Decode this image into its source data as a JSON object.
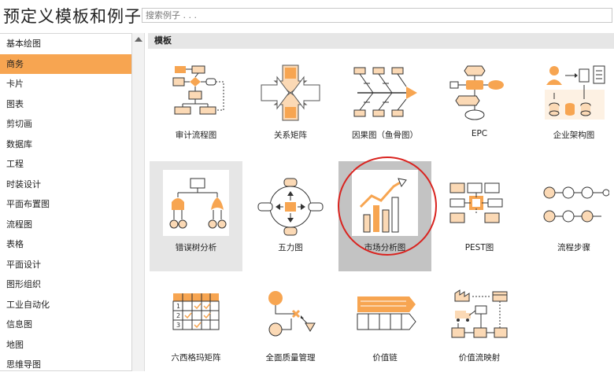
{
  "page": {
    "title": "预定义模板和例子"
  },
  "search": {
    "placeholder": "搜索例子 . . ."
  },
  "sidebar": {
    "items": [
      {
        "label": "基本绘图",
        "active": false
      },
      {
        "label": "商务",
        "active": true
      },
      {
        "label": "卡片",
        "active": false
      },
      {
        "label": "图表",
        "active": false
      },
      {
        "label": "剪切画",
        "active": false
      },
      {
        "label": "数据库",
        "active": false
      },
      {
        "label": "工程",
        "active": false
      },
      {
        "label": "时装设计",
        "active": false
      },
      {
        "label": "平面布置图",
        "active": false
      },
      {
        "label": "流程图",
        "active": false
      },
      {
        "label": "表格",
        "active": false
      },
      {
        "label": "平面设计",
        "active": false
      },
      {
        "label": "图形组织",
        "active": false
      },
      {
        "label": "工业自动化",
        "active": false
      },
      {
        "label": "信息图",
        "active": false
      },
      {
        "label": "地图",
        "active": false
      },
      {
        "label": "思维导图",
        "active": false
      }
    ]
  },
  "main": {
    "header": "模板",
    "templates": [
      {
        "label": "审计流程图",
        "icon": "audit-flowchart-icon"
      },
      {
        "label": "关系矩阵",
        "icon": "relationship-matrix-icon"
      },
      {
        "label": "因果图（鱼骨图）",
        "icon": "fishbone-icon"
      },
      {
        "label": "EPC",
        "icon": "epc-icon"
      },
      {
        "label": "企业架构图",
        "icon": "enterprise-architecture-icon"
      },
      {
        "label": "错误树分析",
        "icon": "fault-tree-icon"
      },
      {
        "label": "五力图",
        "icon": "five-forces-icon"
      },
      {
        "label": "市场分析图",
        "icon": "market-analysis-icon"
      },
      {
        "label": "PEST图",
        "icon": "pest-icon"
      },
      {
        "label": "流程步骤",
        "icon": "process-steps-icon"
      },
      {
        "label": "六西格玛矩阵",
        "icon": "six-sigma-matrix-icon"
      },
      {
        "label": "全面质量管理",
        "icon": "tqm-icon"
      },
      {
        "label": "价值链",
        "icon": "value-chain-icon"
      },
      {
        "label": "价值流映射",
        "icon": "value-stream-icon"
      }
    ]
  },
  "colors": {
    "accent": "#f7a551",
    "accent_light": "#fbd9b5",
    "highlight_ring": "#d9231f"
  }
}
